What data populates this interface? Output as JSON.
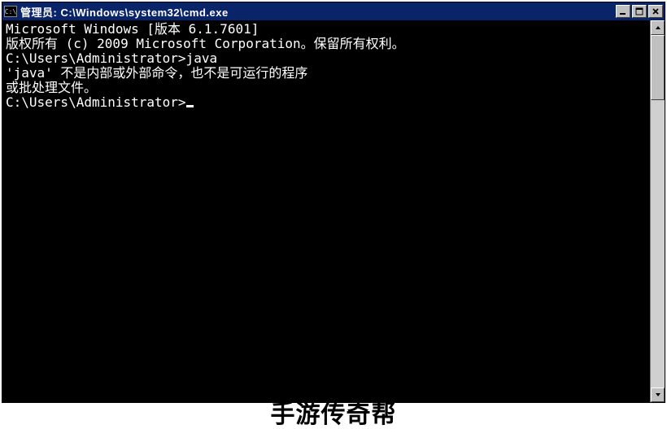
{
  "window": {
    "icon_text": "C:\\",
    "title": "管理员: C:\\Windows\\system32\\cmd.exe"
  },
  "terminal": {
    "lines": [
      "Microsoft Windows [版本 6.1.7601]",
      "版权所有 (c) 2009 Microsoft Corporation。保留所有权利。",
      "",
      "C:\\Users\\Administrator>java",
      "'java' 不是内部或外部命令，也不是可运行的程序",
      "或批处理文件。",
      "",
      "C:\\Users\\Administrator>"
    ]
  },
  "watermark": "手游传奇帮"
}
